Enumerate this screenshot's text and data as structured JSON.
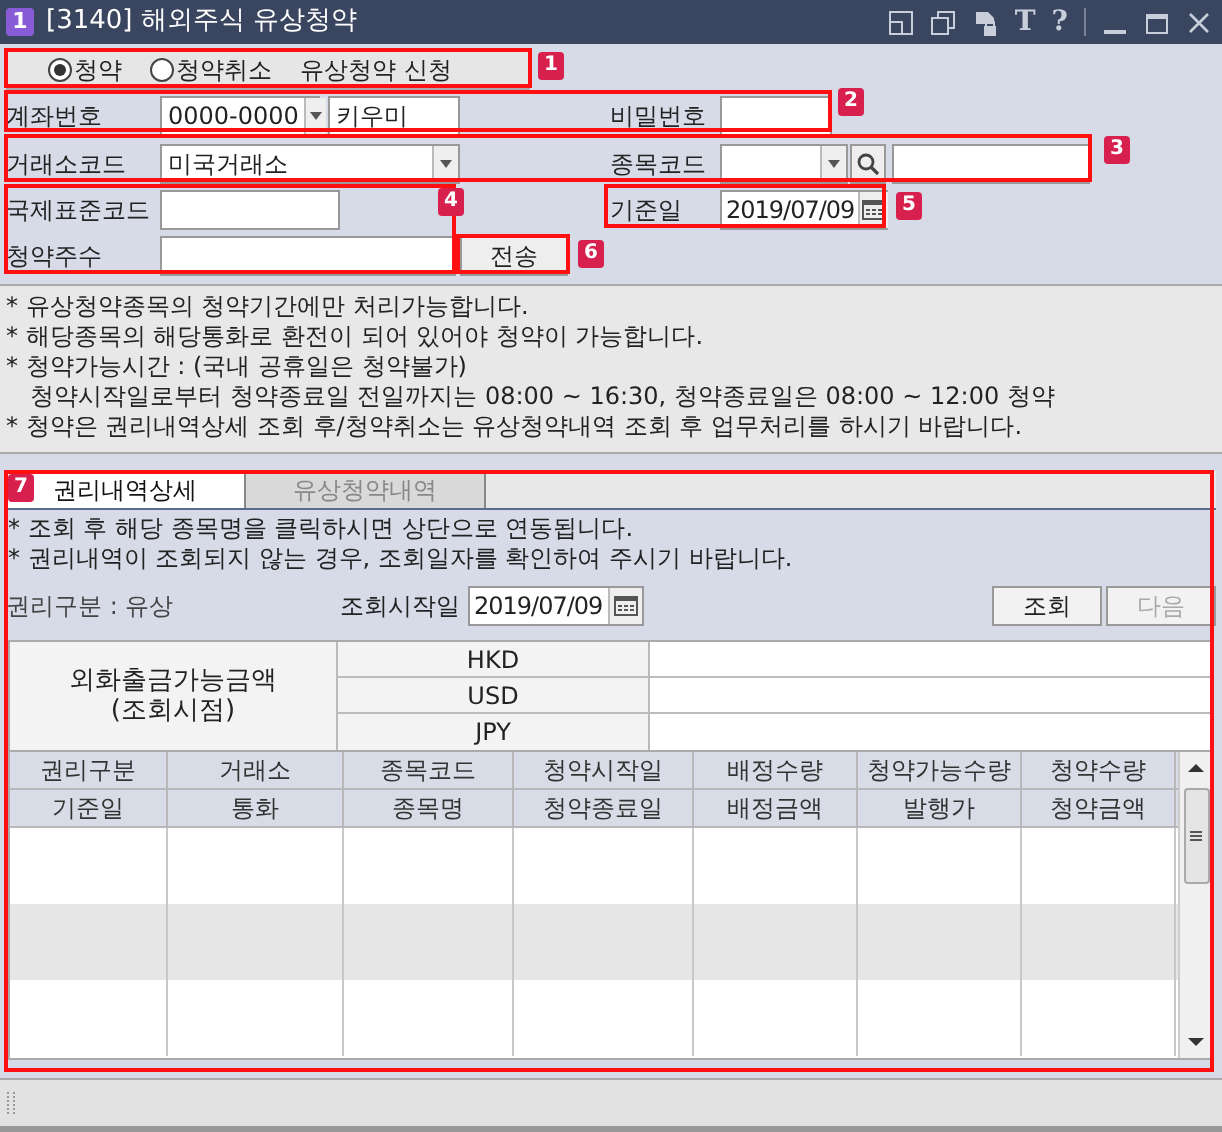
{
  "window": {
    "number": "1",
    "title": "[3140] 해외주식 유상청약",
    "tools": [
      "T",
      "?"
    ]
  },
  "mode": {
    "options": [
      {
        "label": "청약",
        "selected": true
      },
      {
        "label": "청약취소",
        "selected": false
      }
    ],
    "caption": "유상청약 신청"
  },
  "account": {
    "label": "계좌번호",
    "number": "0000-0000",
    "name": "키우미"
  },
  "password": {
    "label": "비밀번호"
  },
  "exchange": {
    "label": "거래소코드",
    "value": "미국거래소"
  },
  "stock_code": {
    "label": "종목코드"
  },
  "isin": {
    "label": "국제표준코드"
  },
  "base_date": {
    "label": "기준일",
    "value": "2019/07/09"
  },
  "shares": {
    "label": "청약주수"
  },
  "send_button": "전송",
  "notes": [
    {
      "kind": "bullet",
      "text": "* 유상청약종목의 청약기간에만 처리가능합니다."
    },
    {
      "kind": "bullet",
      "text": "* 해당종목의 해당통화로 환전이 되어 있어야 청약이 가능합니다."
    },
    {
      "kind": "bullet",
      "text": "* 청약가능시간 : (국내 공휴일은 청약불가)"
    },
    {
      "kind": "continuation",
      "text": "청약시작일로부터 청약종료일 전일까지는 08:00 ~ 16:30, 청약종료일은 08:00 ~ 12:00 청약"
    },
    {
      "kind": "bullet",
      "text": "* 청약은 권리내역상세 조회 후/청약취소는 유상청약내역 조회 후 업무처리를 하시기 바랍니다."
    }
  ],
  "tabs": [
    {
      "label": "권리내역상세",
      "selected": true
    },
    {
      "label": "유상청약내역",
      "selected": false
    }
  ],
  "detail": {
    "notes": [
      "* 조회 후 해당 종목명을 클릭하시면 상단으로 연동됩니다.",
      "* 권리내역이 조회되지 않는 경우, 조회일자를 확인하여 주시기 바랍니다."
    ],
    "category": "권리구분 : 유상",
    "start_date_label": "조회시작일",
    "start_date": "2019/07/09",
    "buttons": [
      {
        "label": "조회",
        "disabled": false
      },
      {
        "label": "다음",
        "disabled": true
      }
    ]
  },
  "balance": {
    "label": "외화출금가능금액",
    "sublabel": "(조회시점)",
    "currencies": [
      "HKD",
      "USD",
      "JPY"
    ]
  },
  "grid": {
    "header_rows": [
      [
        "권리구분",
        "거래소",
        "종목코드",
        "청약시작일",
        "배정수량",
        "청약가능수량",
        "청약수량"
      ],
      [
        "기준일",
        "통화",
        "종목명",
        "청약종료일",
        "배정금액",
        "발행가",
        "청약금액"
      ]
    ]
  },
  "annotations": [
    "1",
    "2",
    "3",
    "4",
    "5",
    "6",
    "7"
  ]
}
